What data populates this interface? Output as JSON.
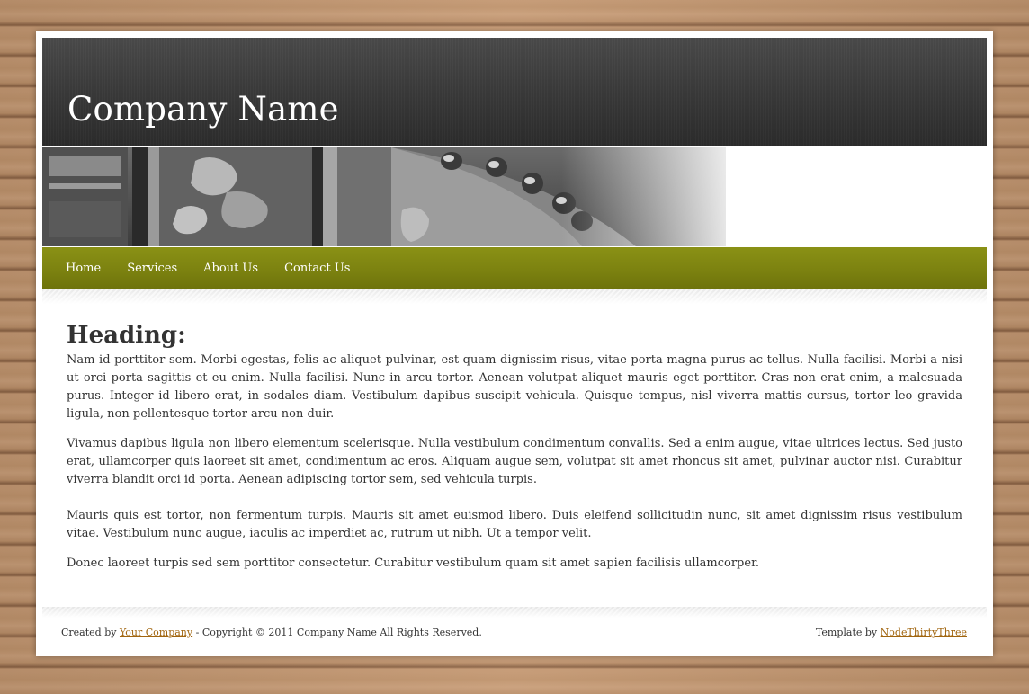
{
  "header": {
    "site_title": "Company Name"
  },
  "nav": {
    "items": [
      {
        "label": "Home"
      },
      {
        "label": "Services"
      },
      {
        "label": "About Us"
      },
      {
        "label": "Contact Us"
      }
    ]
  },
  "main": {
    "heading": "Heading:",
    "paragraphs": [
      "Nam id porttitor sem. Morbi egestas, felis ac aliquet pulvinar, est quam dignissim risus, vitae porta magna purus ac tellus. Nulla facilisi. Morbi a nisi ut orci porta sagittis et eu enim. Nulla facilisi. Nunc in arcu tortor. Aenean volutpat aliquet mauris eget porttitor. Cras non erat enim, a malesuada purus. Integer id libero erat, in sodales diam. Vestibulum dapibus suscipit vehicula. Quisque tempus, nisl viverra mattis cursus, tortor leo gravida ligula, non pellentesque tortor arcu non duir.",
      "Vivamus dapibus ligula non libero elementum scelerisque. Nulla vestibulum condimentum convallis. Sed a enim augue, vitae ultrices lectus. Sed justo erat, ullamcorper quis laoreet sit amet, condimentum ac eros. Aliquam augue sem, volutpat sit amet rhoncus sit amet, pulvinar auctor nisi. Curabitur viverra blandit orci id porta. Aenean adipiscing tortor sem, sed vehicula turpis.",
      "Mauris quis est tortor, non fermentum turpis. Mauris sit amet euismod libero. Duis eleifend sollicitudin nunc, sit amet dignissim risus vestibulum vitae. Vestibulum nunc augue, iaculis ac imperdiet ac, rutrum ut nibh. Ut a tempor velit.",
      "Donec laoreet turpis sed sem porttitor consectetur. Curabitur vestibulum quam sit amet sapien facilisis ullamcorper."
    ]
  },
  "footer": {
    "created_by_prefix": "Created by ",
    "created_by_link": "Your Company",
    "copyright": " - Copyright © 2011 Company Name All Rights Reserved.",
    "template_prefix": "Template by ",
    "template_link": "NodeThirtyThree"
  },
  "colors": {
    "nav_green": "#7c8210",
    "header_dark": "#3a3a3a",
    "link_color": "#a1650f",
    "text_color": "#333333"
  }
}
